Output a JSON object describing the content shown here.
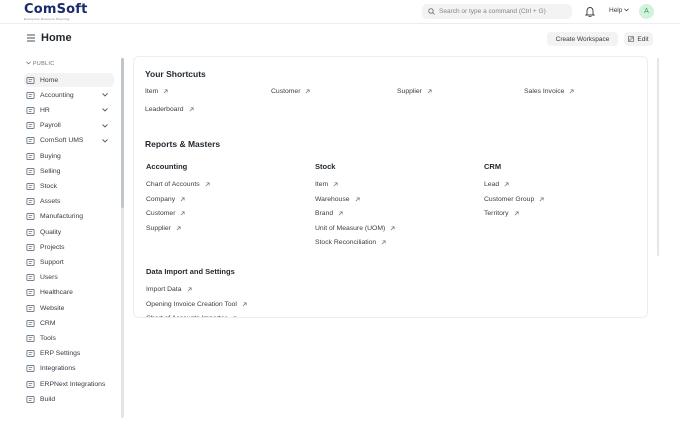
{
  "navbar": {
    "logo_text": "ComSoft",
    "logo_sub": "Enterprise Resource Planning",
    "search_placeholder": "Search or type a command (Ctrl + G)",
    "help_label": "Help",
    "avatar_letter": "A"
  },
  "page": {
    "title": "Home",
    "create_workspace_label": "Create Workspace",
    "edit_label": "Edit"
  },
  "sidebar": {
    "section_label": "PUBLIC",
    "items": [
      {
        "label": "Home",
        "icon": "home-icon",
        "active": true
      },
      {
        "label": "Accounting",
        "icon": "accounting-icon",
        "expandable": true
      },
      {
        "label": "HR",
        "icon": "hr-icon",
        "expandable": true
      },
      {
        "label": "Payroll",
        "icon": "payroll-icon",
        "expandable": true
      },
      {
        "label": "ComSoft UMS",
        "icon": "ums-icon",
        "expandable": true
      },
      {
        "label": "Buying",
        "icon": "buying-icon"
      },
      {
        "label": "Selling",
        "icon": "selling-icon"
      },
      {
        "label": "Stock",
        "icon": "stock-icon"
      },
      {
        "label": "Assets",
        "icon": "assets-icon"
      },
      {
        "label": "Manufacturing",
        "icon": "manufacturing-icon"
      },
      {
        "label": "Quality",
        "icon": "quality-icon"
      },
      {
        "label": "Projects",
        "icon": "projects-icon"
      },
      {
        "label": "Support",
        "icon": "support-icon"
      },
      {
        "label": "Users",
        "icon": "users-icon"
      },
      {
        "label": "Healthcare",
        "icon": "healthcare-icon"
      },
      {
        "label": "Website",
        "icon": "website-icon"
      },
      {
        "label": "CRM",
        "icon": "crm-icon"
      },
      {
        "label": "Tools",
        "icon": "tools-icon"
      },
      {
        "label": "ERP Settings",
        "icon": "settings-icon"
      },
      {
        "label": "Integrations",
        "icon": "integrations-icon"
      },
      {
        "label": "ERPNext Integrations",
        "icon": "erpnext-integrations-icon"
      },
      {
        "label": "Build",
        "icon": "build-icon"
      }
    ]
  },
  "shortcuts": {
    "title": "Your Shortcuts",
    "items": [
      "Item",
      "Customer",
      "Supplier",
      "Sales Invoice",
      "Leaderboard"
    ]
  },
  "reports": {
    "title": "Reports & Masters",
    "columns": [
      {
        "title": "Accounting",
        "links": [
          "Chart of Accounts",
          "Company",
          "Customer",
          "Supplier"
        ]
      },
      {
        "title": "Stock",
        "links": [
          "Item",
          "Warehouse",
          "Brand",
          "Unit of Measure (UOM)",
          "Stock Reconciliation"
        ]
      },
      {
        "title": "CRM",
        "links": [
          "Lead",
          "Customer Group",
          "Territory"
        ]
      }
    ],
    "data_import": {
      "title": "Data Import and Settings",
      "links": [
        "Import Data",
        "Opening Invoice Creation Tool",
        "Chart of Accounts Importer"
      ]
    }
  },
  "colors": {
    "accent_green": "#2f9d58",
    "logo_blue": "#1a2a6c",
    "active_bg": "#f3f3f3"
  }
}
